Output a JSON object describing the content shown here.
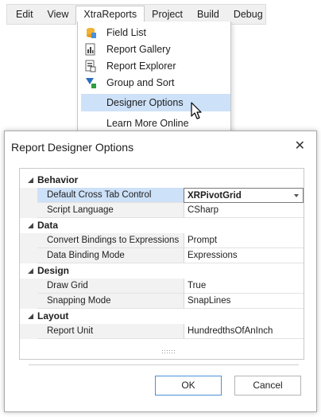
{
  "menubar": {
    "items": [
      "Edit",
      "View",
      "XtraReports",
      "Project",
      "Build",
      "Debug"
    ],
    "open_item": "XtraReports"
  },
  "dropdown": {
    "items": [
      {
        "label": "Field List",
        "icon": "field-list-icon"
      },
      {
        "label": "Report Gallery",
        "icon": "report-gallery-icon"
      },
      {
        "label": "Report Explorer",
        "icon": "report-explorer-icon"
      },
      {
        "label": "Group and Sort",
        "icon": "group-sort-icon"
      },
      {
        "label": "Designer Options",
        "icon": ""
      },
      {
        "label": "Learn More Online",
        "icon": ""
      }
    ],
    "highlighted": "Designer Options"
  },
  "dialog": {
    "title": "Report Designer Options",
    "close_glyph": "✕",
    "categories": [
      {
        "name": "Behavior",
        "properties": [
          {
            "name": "Default Cross Tab Control",
            "value": "XRPivotGrid",
            "selected": true,
            "editor": "combo"
          },
          {
            "name": "Script Language",
            "value": "CSharp"
          }
        ]
      },
      {
        "name": "Data",
        "properties": [
          {
            "name": "Convert Bindings to Expressions",
            "value": "Prompt"
          },
          {
            "name": "Data Binding Mode",
            "value": "Expressions"
          }
        ]
      },
      {
        "name": "Design",
        "properties": [
          {
            "name": "Draw Grid",
            "value": "True"
          },
          {
            "name": "Snapping Mode",
            "value": "SnapLines"
          }
        ]
      },
      {
        "name": "Layout",
        "properties": [
          {
            "name": "Report Unit",
            "value": "HundredthsOfAnInch"
          }
        ]
      }
    ],
    "ok_label": "OK",
    "cancel_label": "Cancel"
  },
  "colors": {
    "highlight": "#cde1f8",
    "ok_border": "#4a90d9",
    "menubar_bg": "#f0f0f0"
  }
}
